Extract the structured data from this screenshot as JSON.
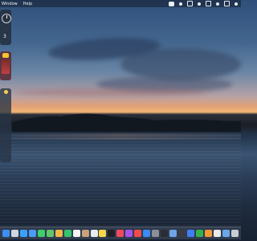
{
  "menubar": {
    "items": [
      "Window",
      "Help"
    ]
  },
  "widgets": {
    "clock_number": "3",
    "weather_rows": [
      "",
      "",
      "",
      "",
      "",
      "",
      "",
      "",
      ""
    ]
  },
  "dock": {
    "icons": [
      {
        "name": "finder-icon",
        "color": "#3c8ef5"
      },
      {
        "name": "launchpad-icon",
        "color": "#cfd6e2"
      },
      {
        "name": "safari-icon",
        "color": "#3aa0ff"
      },
      {
        "name": "mail-icon",
        "color": "#4a9af7"
      },
      {
        "name": "messages-icon",
        "color": "#3ccf6b"
      },
      {
        "name": "maps-icon",
        "color": "#64c46b"
      },
      {
        "name": "photos-icon",
        "color": "#f0b84a"
      },
      {
        "name": "facetime-icon",
        "color": "#33c46d"
      },
      {
        "name": "calendar-icon",
        "color": "#f4f4f4"
      },
      {
        "name": "contacts-icon",
        "color": "#c9a27a"
      },
      {
        "name": "reminders-icon",
        "color": "#e8ecf1"
      },
      {
        "name": "notes-icon",
        "color": "#f7d64a"
      },
      {
        "name": "tv-icon",
        "color": "#1f1f25"
      },
      {
        "name": "music-icon",
        "color": "#f24a5b"
      },
      {
        "name": "podcasts-icon",
        "color": "#a553e8"
      },
      {
        "name": "news-icon",
        "color": "#f24b4b"
      },
      {
        "name": "app-store-icon",
        "color": "#3a8bf5"
      },
      {
        "name": "system-settings-icon",
        "color": "#8a8f99"
      },
      {
        "name": "terminal-icon",
        "color": "#2a2d33"
      },
      {
        "name": "preview-icon",
        "color": "#6fa5e6"
      },
      {
        "name": "calculator-icon",
        "color": "#3a3c42"
      },
      {
        "name": "keynote-icon",
        "color": "#3f7ff1"
      },
      {
        "name": "numbers-icon",
        "color": "#32b24d"
      },
      {
        "name": "pages-icon",
        "color": "#f29a35"
      },
      {
        "name": "chrome-icon",
        "color": "#eaeaea"
      },
      {
        "name": "folder-icon",
        "color": "#69a7ea"
      },
      {
        "name": "trash-icon",
        "color": "#c7ccd4"
      }
    ]
  }
}
